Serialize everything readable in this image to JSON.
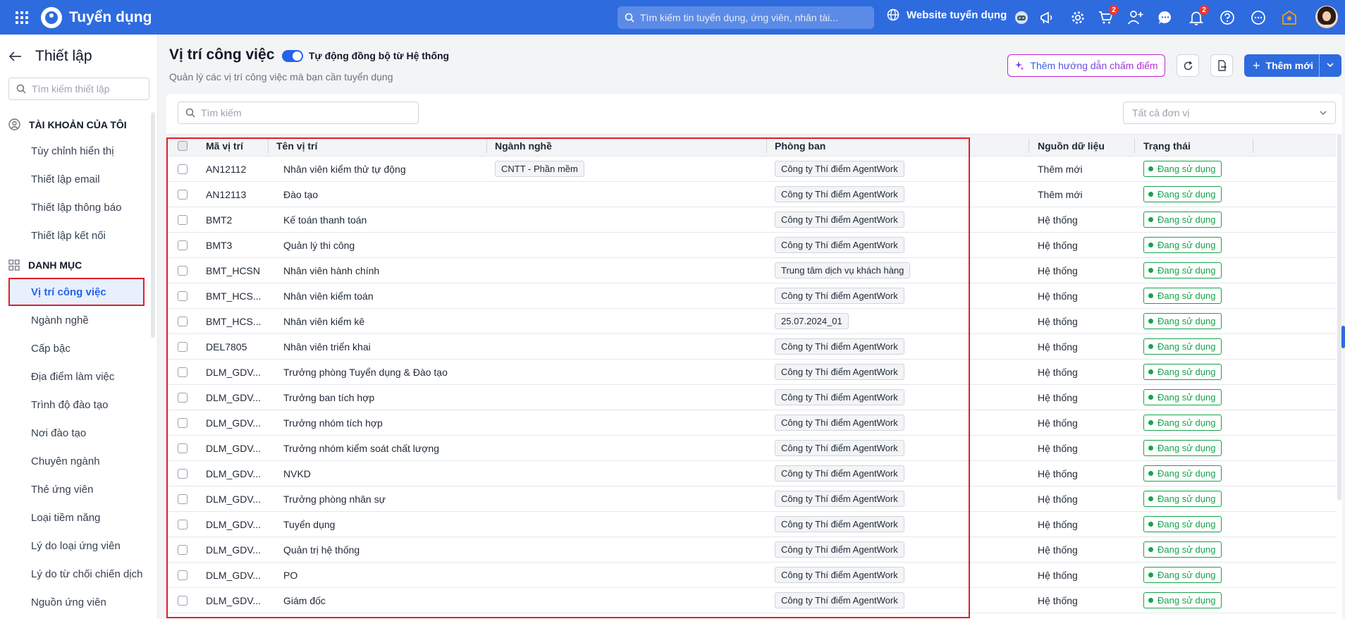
{
  "topbar": {
    "app_title": "Tuyển dụng",
    "search_placeholder": "Tìm kiếm tin tuyển dụng, ứng viên, nhân tài...",
    "website_link": "Website tuyển dụng",
    "cart_badge": "2",
    "notification_badge": "2",
    "brand_color": "#2e6bdf"
  },
  "sidebar": {
    "title": "Thiết lập",
    "search_placeholder": "Tìm kiếm thiết lập",
    "section_account": "TÀI KHOẢN CỦA TÔI",
    "account_items": [
      "Tùy chỉnh hiển thị",
      "Thiết lập email",
      "Thiết lập thông báo",
      "Thiết lập kết nối"
    ],
    "section_catalog": "DANH MỤC",
    "active_item": "Vị trí công việc",
    "catalog_items": [
      "Ngành nghề",
      "Cấp bậc",
      "Địa điểm làm việc",
      "Trình độ đào tạo",
      "Nơi đào tạo",
      "Chuyên ngành",
      "Thẻ ứng viên",
      "Loại tiềm năng",
      "Lý do loại ứng viên",
      "Lý do từ chối chiến dịch",
      "Nguồn ứng viên"
    ]
  },
  "page": {
    "title": "Vị trí công việc",
    "toggle_label": "Tự động đồng bộ từ Hệ thống",
    "toggle_on": true,
    "description": "Quản lý các vị trí công việc mà bạn cần tuyển dụng",
    "guide_button": "Thêm hướng dẫn chấm điểm",
    "add_button": "Thêm mới",
    "list_search_placeholder": "Tìm kiếm",
    "unit_select_placeholder": "Tất cả đơn vị"
  },
  "table": {
    "headers": {
      "code": "Mã vị trí",
      "name": "Tên vị trí",
      "industry": "Ngành nghề",
      "department": "Phòng ban",
      "source": "Nguồn dữ liệu",
      "status": "Trạng thái"
    },
    "rows": [
      {
        "code": "AN12112",
        "name": "Nhân viên kiểm thử tự động",
        "industry": "CNTT - Phần mềm",
        "department": "Công ty Thí điểm AgentWork",
        "source": "Thêm mới",
        "status": "Đang sử dụng"
      },
      {
        "code": "AN12113",
        "name": "Đào tạo",
        "industry": "",
        "department": "Công ty Thí điểm AgentWork",
        "source": "Thêm mới",
        "status": "Đang sử dụng"
      },
      {
        "code": "BMT2",
        "name": "Kế toán thanh toán",
        "industry": "",
        "department": "Công ty Thí điểm AgentWork",
        "source": "Hệ thống",
        "status": "Đang sử dụng"
      },
      {
        "code": "BMT3",
        "name": "Quản lý thi công",
        "industry": "",
        "department": "Công ty Thí điểm AgentWork",
        "source": "Hệ thống",
        "status": "Đang sử dụng"
      },
      {
        "code": "BMT_HCSN",
        "name": "Nhân viên hành chính",
        "industry": "",
        "department": "Trung tâm dịch vụ khách hàng",
        "source": "Hệ thống",
        "status": "Đang sử dụng"
      },
      {
        "code": "BMT_HCS...",
        "name": "Nhân viên kiểm toán",
        "industry": "",
        "department": "Công ty Thí điểm AgentWork",
        "source": "Hệ thống",
        "status": "Đang sử dụng"
      },
      {
        "code": "BMT_HCS...",
        "name": "Nhân viên kiểm kê",
        "industry": "",
        "department": "25.07.2024_01",
        "source": "Hệ thống",
        "status": "Đang sử dụng"
      },
      {
        "code": "DEL7805",
        "name": "Nhân viên triển khai",
        "industry": "",
        "department": "Công ty Thí điểm AgentWork",
        "source": "Hệ thống",
        "status": "Đang sử dụng"
      },
      {
        "code": "DLM_GDV...",
        "name": "Trưởng phòng Tuyển dụng & Đào tạo",
        "industry": "",
        "department": "Công ty Thí điểm AgentWork",
        "source": "Hệ thống",
        "status": "Đang sử dụng"
      },
      {
        "code": "DLM_GDV...",
        "name": "Trưởng ban tích hợp",
        "industry": "",
        "department": "Công ty Thí điểm AgentWork",
        "source": "Hệ thống",
        "status": "Đang sử dụng"
      },
      {
        "code": "DLM_GDV...",
        "name": "Trưởng nhóm tích hợp",
        "industry": "",
        "department": "Công ty Thí điểm AgentWork",
        "source": "Hệ thống",
        "status": "Đang sử dụng"
      },
      {
        "code": "DLM_GDV...",
        "name": "Trưởng nhóm kiểm soát chất lượng",
        "industry": "",
        "department": "Công ty Thí điểm AgentWork",
        "source": "Hệ thống",
        "status": "Đang sử dụng"
      },
      {
        "code": "DLM_GDV...",
        "name": "NVKD",
        "industry": "",
        "department": "Công ty Thí điểm AgentWork",
        "source": "Hệ thống",
        "status": "Đang sử dụng"
      },
      {
        "code": "DLM_GDV...",
        "name": "Trưởng phòng nhân sự",
        "industry": "",
        "department": "Công ty Thí điểm AgentWork",
        "source": "Hệ thống",
        "status": "Đang sử dụng"
      },
      {
        "code": "DLM_GDV...",
        "name": "Tuyển dụng",
        "industry": "",
        "department": "Công ty Thí điểm AgentWork",
        "source": "Hệ thống",
        "status": "Đang sử dụng"
      },
      {
        "code": "DLM_GDV...",
        "name": "Quản trị hệ thống",
        "industry": "",
        "department": "Công ty Thí điểm AgentWork",
        "source": "Hệ thống",
        "status": "Đang sử dụng"
      },
      {
        "code": "DLM_GDV...",
        "name": "PO",
        "industry": "",
        "department": "Công ty Thí điểm AgentWork",
        "source": "Hệ thống",
        "status": "Đang sử dụng"
      },
      {
        "code": "DLM_GDV...",
        "name": "Giám đốc",
        "industry": "",
        "department": "Công ty Thí điểm AgentWork",
        "source": "Hệ thống",
        "status": "Đang sử dụng"
      }
    ]
  },
  "colors": {
    "accent": "#2563eb",
    "status_green": "#16a34a",
    "highlight_red": "#e11d2a"
  }
}
